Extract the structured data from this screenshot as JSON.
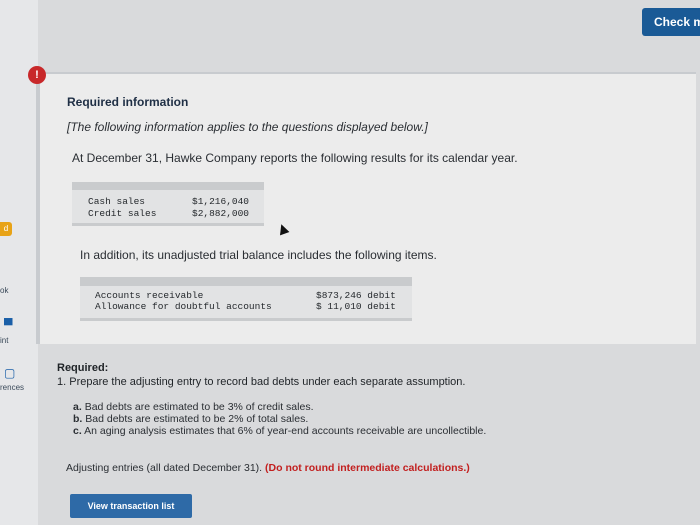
{
  "header": {
    "check_button_label": "Check m"
  },
  "left_rail": {
    "badge_text": "d",
    "item_ok": "ok",
    "item_int": "int",
    "item_rences": "rences"
  },
  "info": {
    "alert_text": "!",
    "title": "Required information",
    "note": "[The following information applies to the questions displayed below.]",
    "intro": "At December 31, Hawke Company reports the following results for its calendar year.",
    "table1": [
      {
        "label": "Cash sales",
        "value": "$1,216,040"
      },
      {
        "label": "Credit sales",
        "value": "$2,882,000"
      }
    ],
    "addition": "In addition, its unadjusted trial balance includes the following items.",
    "table2": [
      {
        "label": "Accounts receivable",
        "value": "$873,246 debit"
      },
      {
        "label": "Allowance for doubtful accounts",
        "value": "$ 11,010 debit"
      }
    ]
  },
  "required": {
    "label": "Required:",
    "step": "1. Prepare the adjusting entry to record bad debts under each separate assumption.",
    "options": [
      {
        "letter": "a.",
        "text": "Bad debts are estimated to be 3% of credit sales."
      },
      {
        "letter": "b.",
        "text": "Bad debts are estimated to be 2% of total sales."
      },
      {
        "letter": "c.",
        "text": "An aging analysis estimates that 6% of year-end accounts receivable are uncollectible."
      }
    ],
    "adjusting_text": "Adjusting entries (all dated December 31).",
    "adjusting_warning": "(Do not round intermediate calculations.)",
    "view_button_label": "View transaction list"
  }
}
